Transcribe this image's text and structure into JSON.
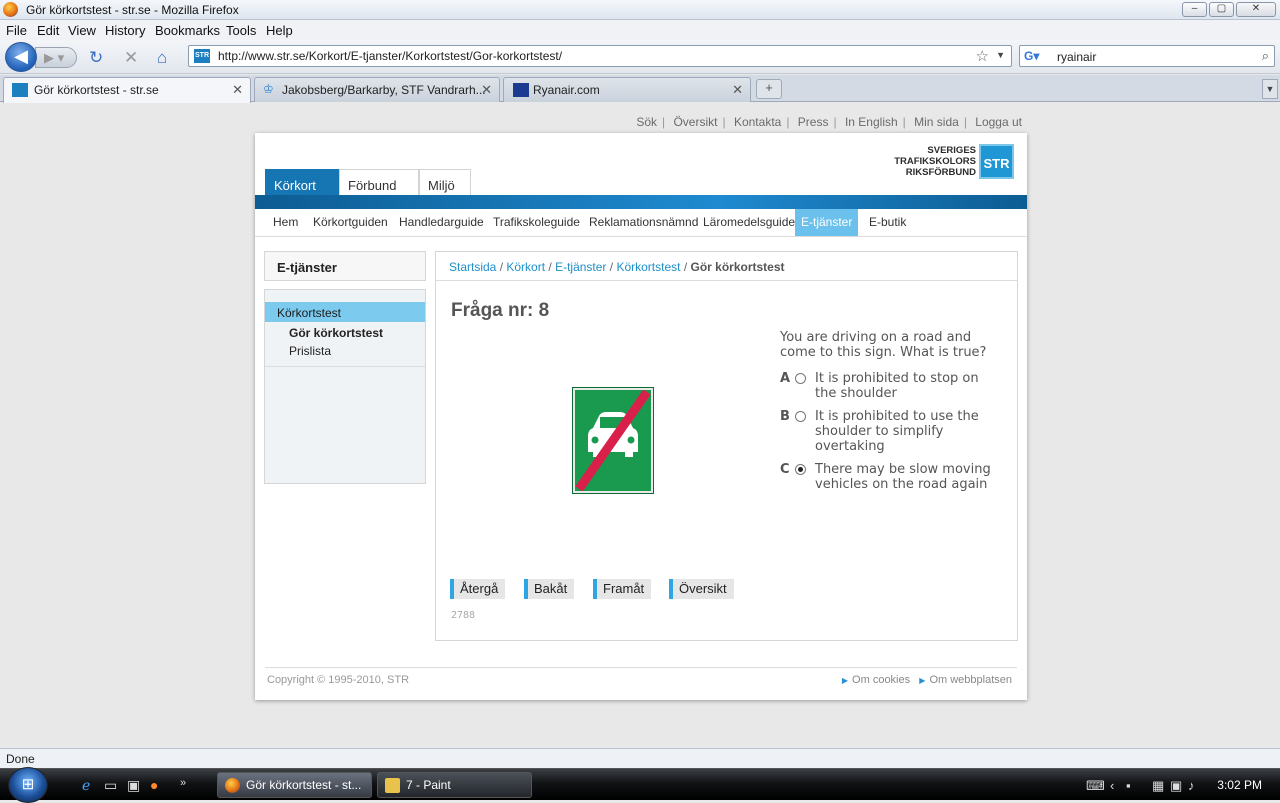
{
  "window": {
    "title": "Gör körkortstest - str.se - Mozilla Firefox",
    "min": "–",
    "max": "▢",
    "close": "✕"
  },
  "menu": [
    "File",
    "Edit",
    "View",
    "History",
    "Bookmarks",
    "Tools",
    "Help"
  ],
  "nav": {
    "url": "http://www.str.se/Korkort/E-tjanster/Korkortstest/Gor-korkortstest/",
    "search_value": "ryainair",
    "favicon_text": "STR"
  },
  "tabs": [
    {
      "title": "Gör körkortstest - str.se",
      "active": true
    },
    {
      "title": "Jakobsberg/Barkarby, STF Vandrarh...",
      "active": false
    },
    {
      "title": "Ryanair.com",
      "active": false
    }
  ],
  "page": {
    "toplinks": [
      "Sök",
      "Översikt",
      "Kontakta",
      "Press",
      "In English",
      "Min sida",
      "Logga ut"
    ],
    "logo": {
      "line1": "SVERIGES",
      "line2": "TRAFIKSKOLORS",
      "line3": "RIKSFÖRBUND",
      "mark": "STR"
    },
    "main_tabs": [
      "Körkort",
      "Förbund",
      "Miljö"
    ],
    "sub_nav": [
      "Hem",
      "Körkortguiden",
      "Handledarguide",
      "Trafikskoleguide",
      "Reklamationsnämnd",
      "Läromedelsguide",
      "E-tjänster",
      "E-butik"
    ],
    "sidebar": {
      "heading": "E-tjänster",
      "items": [
        "Körkortstest",
        "Gör körkortstest",
        "Prislista"
      ]
    },
    "breadcrumb": [
      "Startsida",
      "Körkort",
      "E-tjänster",
      "Körkortstest",
      "Gör körkortstest"
    ],
    "question": {
      "title": "Fråga nr: 8",
      "text": "You are driving on a road and come to this sign. What is true?",
      "options": [
        {
          "key": "A",
          "text": "It is prohibited to stop on the shoulder",
          "selected": false
        },
        {
          "key": "B",
          "text": "It is prohibited to use the shoulder to simplify overtaking",
          "selected": false
        },
        {
          "key": "C",
          "text": "There may be slow moving vehicles on the road again",
          "selected": true
        }
      ],
      "buttons": [
        "Återgå",
        "Bakåt",
        "Framåt",
        "Översikt"
      ],
      "id": "2788"
    },
    "footer": {
      "copyright": "Copyright © 1995-2010, STR",
      "links": [
        "Om cookies",
        "Om webbplatsen"
      ]
    }
  },
  "status": "Done",
  "taskbar": {
    "buttons": [
      "Gör körkortstest - st...",
      "7 - Paint"
    ],
    "time": "3:02 PM"
  }
}
